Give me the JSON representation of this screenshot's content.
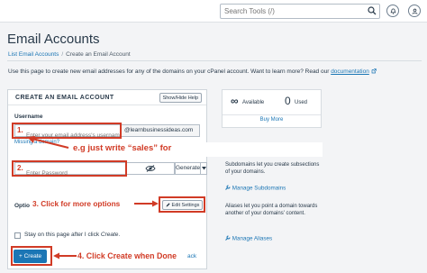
{
  "header": {
    "search_placeholder": "Search Tools (/)",
    "search_icon": "magnifier-icon",
    "notification_icon": "bell-icon",
    "user_icon": "user-icon"
  },
  "page": {
    "title": "Email Accounts",
    "breadcrumb": [
      "List Email Accounts",
      "Create an Email Account"
    ],
    "intro": "Use this page to create new email addresses for any of the domains on your cPanel account. Want to learn more? Read our",
    "doc_link": "documentation"
  },
  "form": {
    "panel_title": "CREATE AN EMAIL ACCOUNT",
    "help_button": "Show/Hide Help",
    "username_label": "Username",
    "username_placeholder": "Enter your email address's username.",
    "domain": "@learnbusinessideas.com",
    "missing_domain_link": "Missing a domain?",
    "password_placeholder": "Enter Password",
    "visibility_icon": "eye-slash-icon",
    "generate_button": "Generate",
    "optional_label": "Optio",
    "edit_settings_button": "Edit Settings",
    "stay_label": "Stay on this page after I click ",
    "stay_label_em": "Create",
    "stay_label_tail": ".",
    "create_button": "+ Create",
    "go_back_fragment": "ack"
  },
  "annotations": {
    "step1": "1.",
    "step2": "2.",
    "step3": "3. Click for more options",
    "step4": "4. Click Create when Done",
    "note": "e.g just write “sales” for"
  },
  "stats": {
    "available_symbol": "∞",
    "available_label": "Available",
    "used_count": "0",
    "used_label": "Used",
    "buy_more": "Buy More"
  },
  "sidebar": {
    "subdomains_text": "Subdomains let you create subsections of your domains.",
    "subdomains_link": "Manage Subdomains",
    "aliases_text": "Aliases let you point a domain towards another of your domains' content.",
    "aliases_link": "Manage Aliases"
  },
  "colors": {
    "accent": "#1b76b5",
    "annotation_red": "#d13b26"
  }
}
